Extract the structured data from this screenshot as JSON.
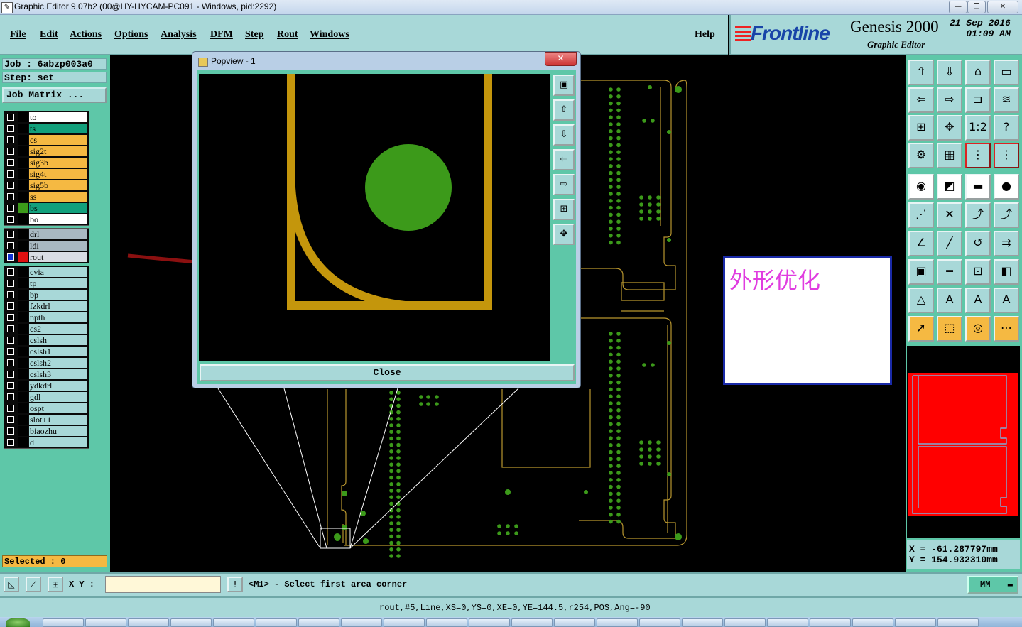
{
  "window": {
    "title": "Graphic Editor 9.07b2 (00@HY-HYCAM-PC091 - Windows, pid:2292)",
    "minimize": "—",
    "maximize": "❐",
    "close": "✕"
  },
  "menu": {
    "items": [
      "File",
      "Edit",
      "Actions",
      "Options",
      "Analysis",
      "DFM",
      "Step",
      "Rout",
      "Windows"
    ],
    "help": "Help"
  },
  "brand": {
    "logo": "Frontline",
    "product": "Genesis 2000",
    "subtitle": "Graphic Editor",
    "date": "21 Sep 2016",
    "time": "01:09 AM"
  },
  "job": {
    "job_label": "Job : 6abzp003a0",
    "step_label": "Step: set",
    "matrix_button": "Job Matrix ..."
  },
  "layers": {
    "group1": [
      {
        "name": "to",
        "swatch": "#000000",
        "bg": "#ffffff"
      },
      {
        "name": "ts",
        "swatch": "#000000",
        "bg": "#12a07c"
      },
      {
        "name": "cs",
        "swatch": "#000000",
        "bg": "#f5b942"
      },
      {
        "name": "sig2t",
        "swatch": "#000000",
        "bg": "#f5b942"
      },
      {
        "name": "sig3b",
        "swatch": "#000000",
        "bg": "#f5b942"
      },
      {
        "name": "sig4t",
        "swatch": "#000000",
        "bg": "#f5b942"
      },
      {
        "name": "sig5b",
        "swatch": "#000000",
        "bg": "#f5b942"
      },
      {
        "name": "ss",
        "swatch": "#000000",
        "bg": "#f5b942"
      },
      {
        "name": "bs",
        "swatch": "#3c9a1a",
        "bg": "#12a07c"
      },
      {
        "name": "bo",
        "swatch": "#000000",
        "bg": "#ffffff"
      }
    ],
    "group2": [
      {
        "name": "drl",
        "swatch": "#000000",
        "bg": "#a9b9c2"
      },
      {
        "name": "ldi",
        "swatch": "#000000",
        "bg": "#a9b9c2"
      },
      {
        "name": "rout",
        "swatch": "#e01010",
        "bg": "#d9dde4"
      }
    ],
    "group3": [
      {
        "name": "cvia"
      },
      {
        "name": "tp"
      },
      {
        "name": "bp"
      },
      {
        "name": "fzkdrl"
      },
      {
        "name": "npth"
      },
      {
        "name": "cs2"
      },
      {
        "name": "cslsh"
      },
      {
        "name": "cslsh1"
      },
      {
        "name": "cslsh2"
      },
      {
        "name": "cslsh3"
      },
      {
        "name": "ydkdrl"
      },
      {
        "name": "gdl"
      },
      {
        "name": "ospt"
      },
      {
        "name": "slot+1"
      },
      {
        "name": "biaozhu"
      },
      {
        "name": "d"
      }
    ]
  },
  "selected": "Selected : 0",
  "popup": {
    "title": "Popview - 1",
    "close_x": "✕",
    "close_button": "Close"
  },
  "annotation": {
    "text": "外形优化"
  },
  "coords": {
    "x": "X  =  -61.287797mm",
    "y": "Y  =  154.932310mm"
  },
  "command": {
    "xy_label": "X Y :",
    "xy_value": "",
    "alert": "!",
    "prompt": "<M1> - Select first area corner",
    "units": "MM"
  },
  "status": {
    "text": "rout,#5,Line,XS=0,YS=0,XE=0,YE=144.5,r254,POS,Ang=-90"
  },
  "toolbar_icons": [
    "home-up-icon",
    "home-down-icon",
    "house-icon",
    "window-icon",
    "pan-left-icon",
    "pan-right-icon",
    "mirror-icon",
    "s-curve-icon",
    "zoom-fit-icon",
    "zoom-center-icon",
    "scale-1-2-icon",
    "help-icon",
    "settings-icon",
    "grid-icon",
    "snap-on-icon",
    "snap-off-icon",
    "pad-icon",
    "measure-icon",
    "ruler-icon",
    "dot-icon",
    "connect-icon",
    "cross-icon",
    "route-icon",
    "route-alt-icon",
    "angle-icon",
    "line-icon",
    "arc-icon",
    "split-icon",
    "select-box-icon",
    "cut-icon",
    "fit-box-icon",
    "group-icon",
    "warning-a-icon",
    "warning-b-icon",
    "warning-c-icon",
    "warning-d-icon",
    "pointer-icon",
    "pointer-box-icon",
    "pointer-circle-icon",
    "pointer-multi-icon"
  ],
  "toolbar_glyphs": [
    "⇧",
    "⇩",
    "⌂",
    "▭",
    "⇦",
    "⇨",
    "⊐",
    "≋",
    "⊞",
    "✥",
    "1:2",
    "?",
    "⚙",
    "▦",
    "⋮",
    "⋮",
    "◉",
    "◩",
    "▬",
    "●",
    "⋰",
    "✕",
    "⤴",
    "⤴",
    "∠",
    "╱",
    "↺",
    "⇉",
    "▣",
    "━",
    "⊡",
    "◧",
    "△",
    "A",
    "A",
    "A",
    "➚",
    "⬚",
    "◎",
    "⋯"
  ],
  "popup_tools": [
    "▣",
    "⇧",
    "⇩",
    "⇦",
    "⇨",
    "⊞",
    "✥"
  ]
}
